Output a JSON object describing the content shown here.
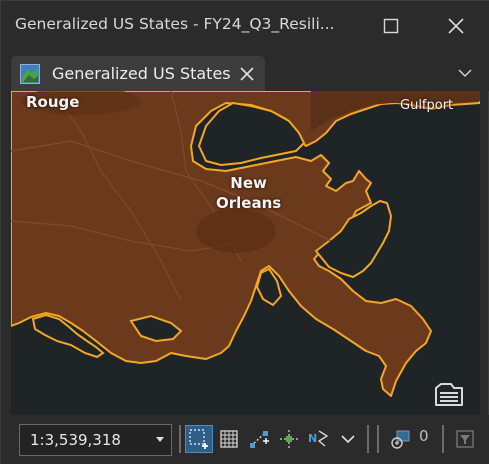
{
  "window": {
    "title": "Generalized US States - FY24_Q3_Resili..."
  },
  "tab": {
    "label": "Generalized US States",
    "icon": "map-layer-icon"
  },
  "map": {
    "labels": {
      "rouge": "Rouge",
      "new_orleans_line1": "New",
      "new_orleans_line2": "Orleans",
      "gulfport": "Gulfport"
    },
    "colors": {
      "land": "#6b3a1d",
      "water": "#1f2427",
      "boundary": "#f5a623"
    }
  },
  "statusbar": {
    "scale": "1:3,539,318",
    "selected_count": "0",
    "tools": [
      "snapping",
      "grid",
      "constraints",
      "correction",
      "north-arrow",
      "more"
    ]
  }
}
